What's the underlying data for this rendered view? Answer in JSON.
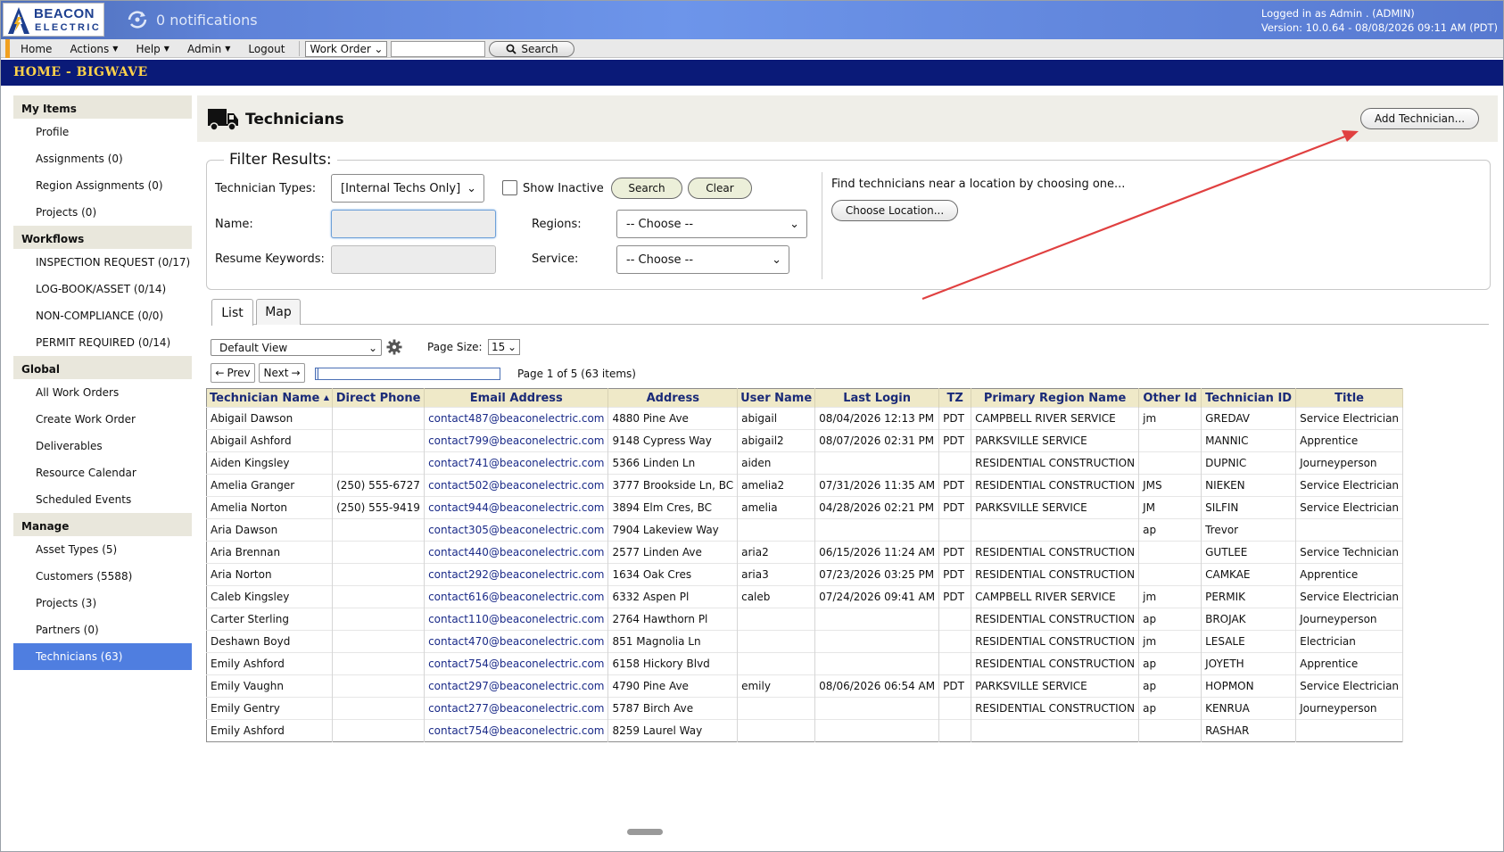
{
  "header": {
    "logo_line1": "BEACON",
    "logo_line2": "ELECTRIC",
    "notifications": "0 notifications",
    "login_line": "Logged in as Admin . (ADMIN)",
    "version_line": "Version: 10.0.64 - 08/08/2026 09:11 AM (PDT)"
  },
  "menu": {
    "home": "Home",
    "actions": "Actions",
    "help": "Help",
    "admin": "Admin",
    "logout": "Logout",
    "search_type": "Work Order",
    "search_value": "",
    "search_button": "Search"
  },
  "pagebar": {
    "title": "HOME - BIGWAVE"
  },
  "sidebar": {
    "sections": [
      {
        "title": "My Items",
        "items": [
          "Profile",
          "Assignments (0)",
          "Region Assignments (0)",
          "Projects (0)"
        ]
      },
      {
        "title": "Workflows",
        "items": [
          "INSPECTION REQUEST (0/17)",
          "LOG-BOOK/ASSET (0/14)",
          "NON-COMPLIANCE (0/0)",
          "PERMIT REQUIRED (0/14)"
        ]
      },
      {
        "title": "Global",
        "items": [
          "All Work Orders",
          "Create Work Order",
          "Deliverables",
          "Resource Calendar",
          "Scheduled Events"
        ]
      },
      {
        "title": "Manage",
        "items": [
          "Asset Types (5)",
          "Customers (5588)",
          "Projects (3)",
          "Partners (0)",
          "Technicians (63)"
        ]
      }
    ],
    "active_item": "Technicians (63)"
  },
  "main": {
    "title": "Technicians",
    "add_button": "Add Technician..."
  },
  "filter": {
    "legend": "Filter Results:",
    "tech_types_label": "Technician Types:",
    "tech_types_value": "[Internal Techs Only]",
    "show_inactive_label": "Show Inactive",
    "search_button": "Search",
    "clear_button": "Clear",
    "name_label": "Name:",
    "name_value": "",
    "resume_label": "Resume Keywords:",
    "resume_value": "",
    "regions_label": "Regions:",
    "regions_value": "-- Choose --",
    "service_label": "Service:",
    "service_value": "-- Choose --",
    "location_text": "Find technicians near a location by choosing one...",
    "location_button": "Choose Location..."
  },
  "tabs": [
    "List",
    "Map"
  ],
  "list": {
    "view": "Default View",
    "page_size_label": "Page Size:",
    "page_size": "15",
    "prev": "Prev",
    "next": "Next",
    "page_info": "Page 1 of 5 (63 items)",
    "page_progress": 0.2
  },
  "table": {
    "columns": [
      "Technician Name",
      "Direct Phone",
      "Email Address",
      "Address",
      "User Name",
      "Last Login",
      "TZ",
      "Primary Region Name",
      "Other Id",
      "Technician ID",
      "Title"
    ],
    "rows": [
      [
        "Abigail Dawson",
        "",
        "contact487@beaconelectric.com",
        "4880 Pine Ave",
        "abigail",
        "08/04/2026 12:13 PM",
        "PDT",
        "CAMPBELL RIVER SERVICE",
        "jm",
        "GREDAV",
        "Service Electrician"
      ],
      [
        "Abigail Ashford",
        "",
        "contact799@beaconelectric.com",
        "9148 Cypress Way",
        "abigail2",
        "08/07/2026 02:31 PM",
        "PDT",
        "PARKSVILLE SERVICE",
        "",
        "MANNIC",
        "Apprentice"
      ],
      [
        "Aiden Kingsley",
        "",
        "contact741@beaconelectric.com",
        "5366 Linden Ln",
        "aiden",
        "",
        "",
        "RESIDENTIAL CONSTRUCTION",
        "",
        "DUPNIC",
        "Journeyperson"
      ],
      [
        "Amelia Granger",
        "(250) 555-6727",
        "contact502@beaconelectric.com",
        "3777 Brookside Ln, BC",
        "amelia2",
        "07/31/2026 11:35 AM",
        "PDT",
        "RESIDENTIAL CONSTRUCTION",
        "JMS",
        "NIEKEN",
        "Service Electrician"
      ],
      [
        "Amelia Norton",
        "(250) 555-9419",
        "contact944@beaconelectric.com",
        "3894 Elm Cres, BC",
        "amelia",
        "04/28/2026 02:21 PM",
        "PDT",
        "PARKSVILLE SERVICE",
        "JM",
        "SILFIN",
        "Service Electrician"
      ],
      [
        "Aria Dawson",
        "",
        "contact305@beaconelectric.com",
        "7904 Lakeview Way",
        "",
        "",
        "",
        "",
        "ap",
        "Trevor",
        ""
      ],
      [
        "Aria Brennan",
        "",
        "contact440@beaconelectric.com",
        "2577 Linden Ave",
        "aria2",
        "06/15/2026 11:24 AM",
        "PDT",
        "RESIDENTIAL CONSTRUCTION",
        "",
        "GUTLEE",
        "Service Technician"
      ],
      [
        "Aria Norton",
        "",
        "contact292@beaconelectric.com",
        "1634 Oak Cres",
        "aria3",
        "07/23/2026 03:25 PM",
        "PDT",
        "RESIDENTIAL CONSTRUCTION",
        "",
        "CAMKAE",
        "Apprentice"
      ],
      [
        "Caleb Kingsley",
        "",
        "contact616@beaconelectric.com",
        "6332 Aspen Pl",
        "caleb",
        "07/24/2026 09:41 AM",
        "PDT",
        "CAMPBELL RIVER SERVICE",
        "jm",
        "PERMIK",
        "Service Electrician"
      ],
      [
        "Carter Sterling",
        "",
        "contact110@beaconelectric.com",
        "2764 Hawthorn Pl",
        "",
        "",
        "",
        "RESIDENTIAL CONSTRUCTION",
        "ap",
        "BROJAK",
        "Journeyperson"
      ],
      [
        "Deshawn Boyd",
        "",
        "contact470@beaconelectric.com",
        "851 Magnolia Ln",
        "",
        "",
        "",
        "RESIDENTIAL CONSTRUCTION",
        "jm",
        "LESALE",
        "Electrician"
      ],
      [
        "Emily Ashford",
        "",
        "contact754@beaconelectric.com",
        "6158 Hickory Blvd",
        "",
        "",
        "",
        "RESIDENTIAL CONSTRUCTION",
        "ap",
        "JOYETH",
        "Apprentice"
      ],
      [
        "Emily Vaughn",
        "",
        "contact297@beaconelectric.com",
        "4790 Pine Ave",
        "emily",
        "08/06/2026 06:54 AM",
        "PDT",
        "PARKSVILLE SERVICE",
        "ap",
        "HOPMON",
        "Service Electrician"
      ],
      [
        "Emily Gentry",
        "",
        "contact277@beaconelectric.com",
        "5787 Birch Ave",
        "",
        "",
        "",
        "RESIDENTIAL CONSTRUCTION",
        "ap",
        "KENRUA",
        "Journeyperson"
      ],
      [
        "Emily Ashford",
        "",
        "contact754@beaconelectric.com",
        "8259 Laurel Way",
        "",
        "",
        "",
        "",
        "",
        "RASHAR",
        ""
      ]
    ]
  },
  "colors": {
    "header_blue": "#5e82d8",
    "title_navy": "#0a1a78",
    "title_gold": "#ffd34a",
    "active_blue": "#4f7ee0",
    "annotation_red": "#e04040"
  }
}
